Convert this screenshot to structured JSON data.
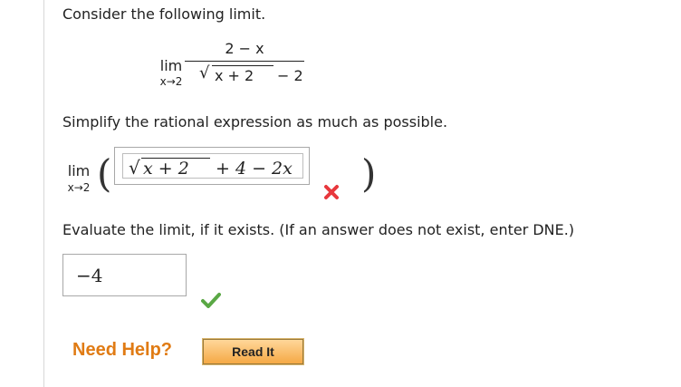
{
  "question": {
    "intro": "Consider the following limit.",
    "limit": {
      "lim": "lim",
      "approach": "x→2",
      "numerator": "2 − x",
      "radical": "√",
      "radicand": "x + 2",
      "denominator_rest": "− 2"
    },
    "simplify_prompt": "Simplify the rational expression as much as possible.",
    "simplify_limit": {
      "lim": "lim",
      "approach": "x→2"
    },
    "evaluate_prompt": "Evaluate the limit, if it exists. (If an answer does not exist, enter DNE.)"
  },
  "answers": {
    "simplified": {
      "radical": "√",
      "radicand": "x + 2",
      "rest": "+ 4 − 2x",
      "status": "incorrect"
    },
    "limit_value": {
      "value": "−4",
      "status": "correct"
    }
  },
  "help": {
    "label": "Need Help?",
    "read_it_button": "Read It"
  },
  "colors": {
    "incorrect": "#e8383d",
    "correct": "#5aa845",
    "help_text": "#e07b14"
  }
}
